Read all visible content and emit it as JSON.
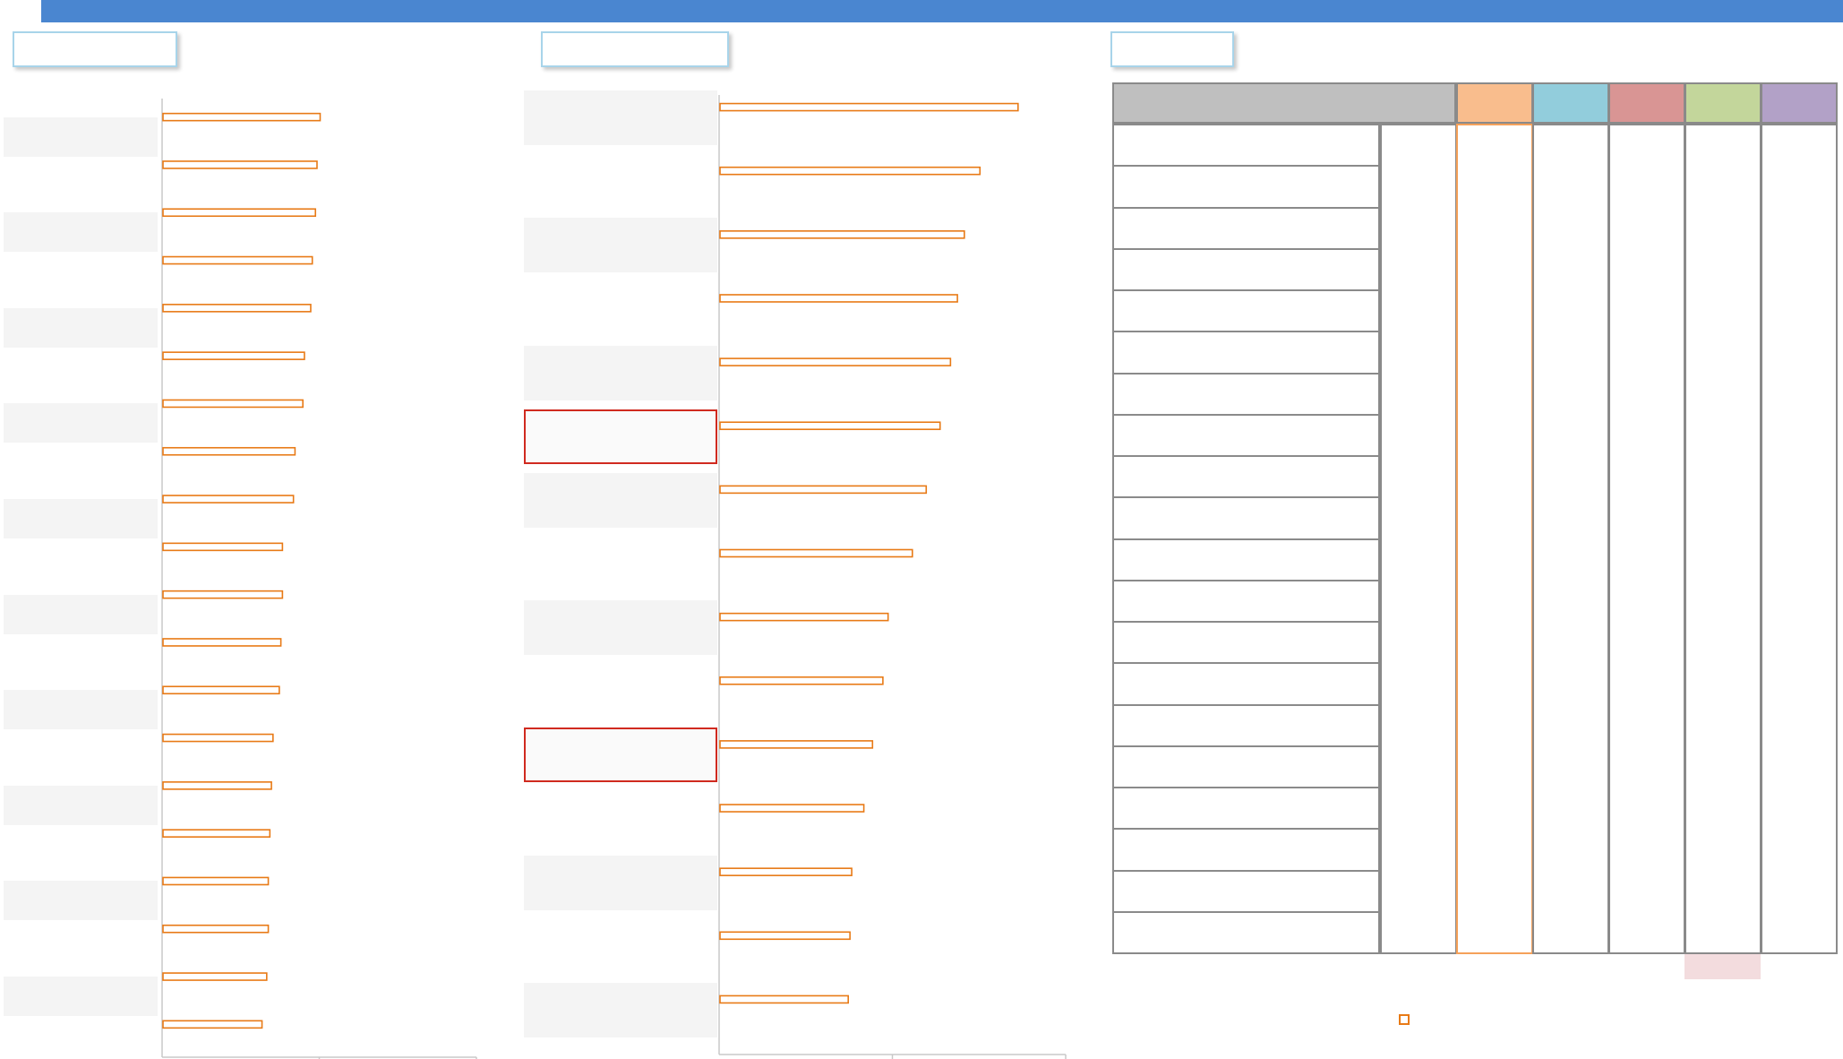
{
  "header": {
    "bar_color": "#4a86d0"
  },
  "tabs": [
    {
      "label": ""
    },
    {
      "label": ""
    },
    {
      "label": ""
    }
  ],
  "chart_data": [
    {
      "type": "bar",
      "orientation": "horizontal",
      "title": "",
      "xlabel": "",
      "ylabel": "",
      "categories": [
        "",
        "",
        "",
        "",
        "",
        "",
        "",
        "",
        "",
        "",
        "",
        "",
        "",
        "",
        "",
        "",
        "",
        "",
        "",
        ""
      ],
      "values": [
        100,
        98,
        97,
        95,
        94,
        90,
        89,
        84,
        83,
        76,
        76,
        75,
        74,
        70,
        69,
        68,
        67,
        67,
        66,
        63
      ],
      "xlim": [
        0,
        200
      ],
      "grid": false,
      "series_color": "#e87a16"
    },
    {
      "type": "bar",
      "orientation": "horizontal",
      "title": "",
      "xlabel": "",
      "ylabel": "",
      "categories": [
        "",
        "",
        "",
        "",
        "",
        "",
        "",
        "",
        "",
        "",
        "",
        "",
        "",
        "",
        ""
      ],
      "values": [
        172,
        150,
        141,
        137,
        133,
        127,
        119,
        111,
        97,
        94,
        88,
        83,
        76,
        75,
        74
      ],
      "highlighted_categories": [
        5,
        10
      ],
      "xlim": [
        0,
        200
      ],
      "grid": false,
      "series_color": "#e87a16"
    }
  ],
  "matrix": {
    "header_label": "",
    "column_colors": [
      "#f9bd8d",
      "#92cddc",
      "#d99594",
      "#c3d69b",
      "#b2a1c7"
    ],
    "border_color": "#8a8a8a",
    "highlight_column_color": "#f5a15a",
    "footer_swatch_color": "#f3dcde",
    "row_labels": [
      "",
      "",
      "",
      "",
      "",
      "",
      "",
      "",
      "",
      "",
      "",
      "",
      "",
      "",
      "",
      "",
      "",
      "",
      "",
      ""
    ]
  },
  "legend": {
    "label": "",
    "marker_color": "#e87a16"
  }
}
